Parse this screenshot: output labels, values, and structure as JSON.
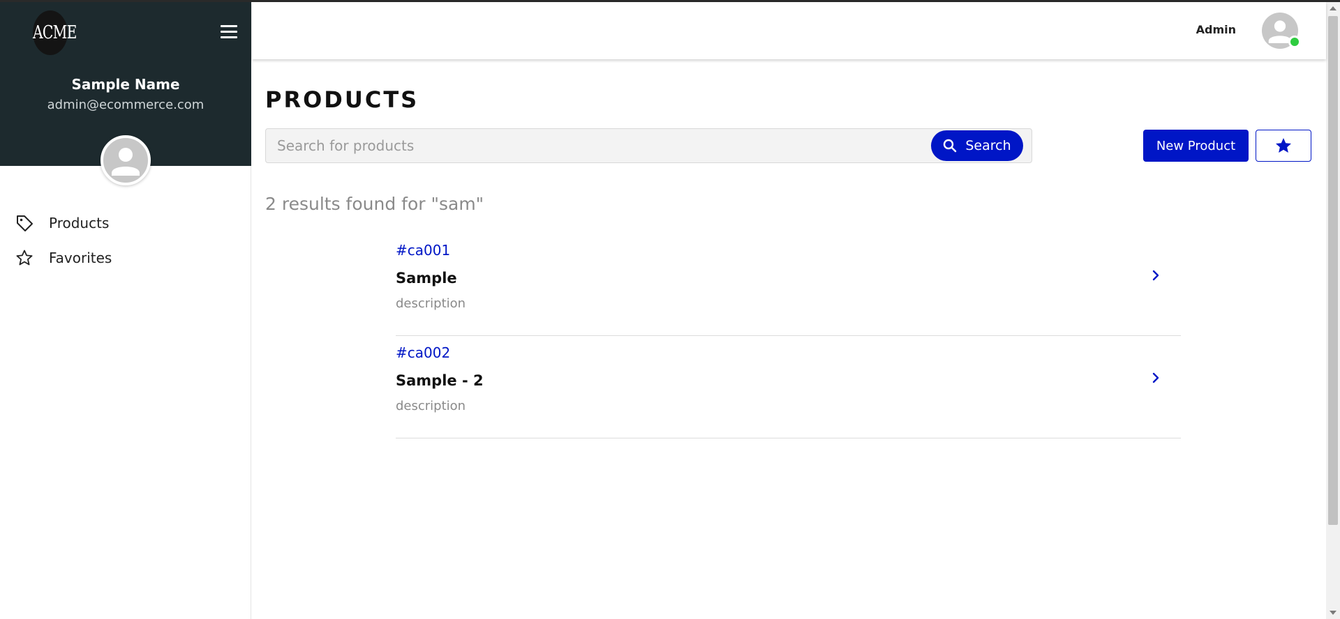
{
  "sidebar": {
    "logo_text": "ACME",
    "user_name": "Sample Name",
    "user_email": "admin@ecommerce.com",
    "nav": [
      {
        "label": "Products",
        "icon": "tag-icon"
      },
      {
        "label": "Favorites",
        "icon": "star-outline-icon"
      }
    ]
  },
  "header": {
    "user_label": "Admin",
    "status_color": "#2ecc40"
  },
  "main": {
    "title": "PRODUCTS",
    "search": {
      "placeholder": "Search for products",
      "value": "",
      "button_label": "Search"
    },
    "new_product_label": "New Product",
    "results_text": "2 results found for \"sam\"",
    "results": [
      {
        "code": "#ca001",
        "name": "Sample",
        "description": "description"
      },
      {
        "code": "#ca002",
        "name": "Sample - 2",
        "description": "description"
      }
    ]
  },
  "colors": {
    "accent": "#0016c6",
    "sidebar_bg": "#1d2a2e"
  }
}
